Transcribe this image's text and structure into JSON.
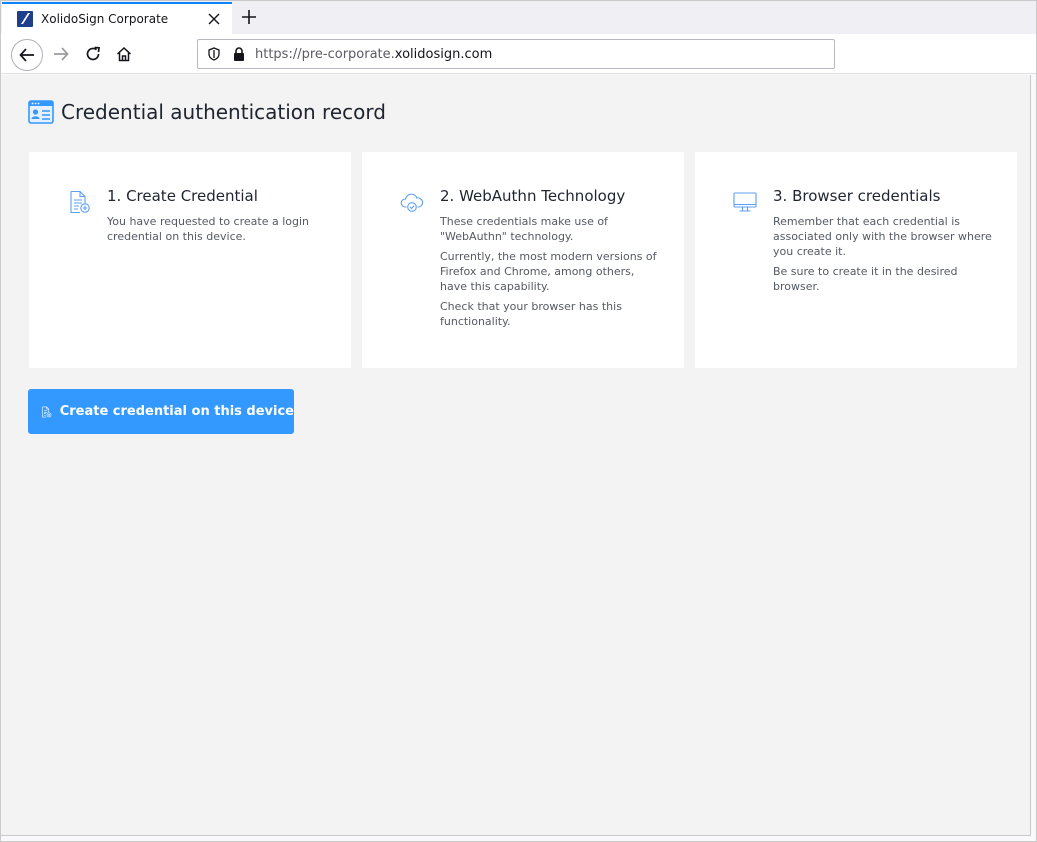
{
  "browser": {
    "tab_title": "XolidoSign Corporate",
    "url_prefix": "https://pre-corporate.",
    "url_domain": "xolidosign.com",
    "accent_color": "#0a84ff"
  },
  "icons": {
    "favicon": "xolidosign-logo-icon",
    "tab_close": "close-icon",
    "new_tab": "plus-icon",
    "back": "arrow-left-icon",
    "forward": "arrow-right-icon",
    "reload": "reload-icon",
    "home": "home-icon",
    "tracking": "shield-icon",
    "secure": "lock-icon",
    "page_title": "id-card-icon",
    "card_1": "document-add-icon",
    "card_2": "cloud-check-icon",
    "card_3": "monitor-icon",
    "button": "document-add-icon"
  },
  "page": {
    "title": "Credential authentication record",
    "background": "#f3f3f3",
    "icon_color": "#3399ff"
  },
  "cards": [
    {
      "title": "1. Create Credential",
      "paragraphs": [
        "You have requested to create a login credential on this device."
      ]
    },
    {
      "title": "2. WebAuthn Technology",
      "paragraphs": [
        "These credentials make use of \"WebAuthn\" technology.",
        "Currently, the most modern versions of Firefox and Chrome, among others, have this capability.",
        "Check that your browser has this functionality."
      ]
    },
    {
      "title": "3. Browser credentials",
      "paragraphs": [
        "Remember that each credential is associated only with the browser where you create it.",
        "Be sure to create it in the desired browser."
      ]
    }
  ],
  "create_button": {
    "label": "Create credential on this device",
    "color": "#3399ff"
  }
}
